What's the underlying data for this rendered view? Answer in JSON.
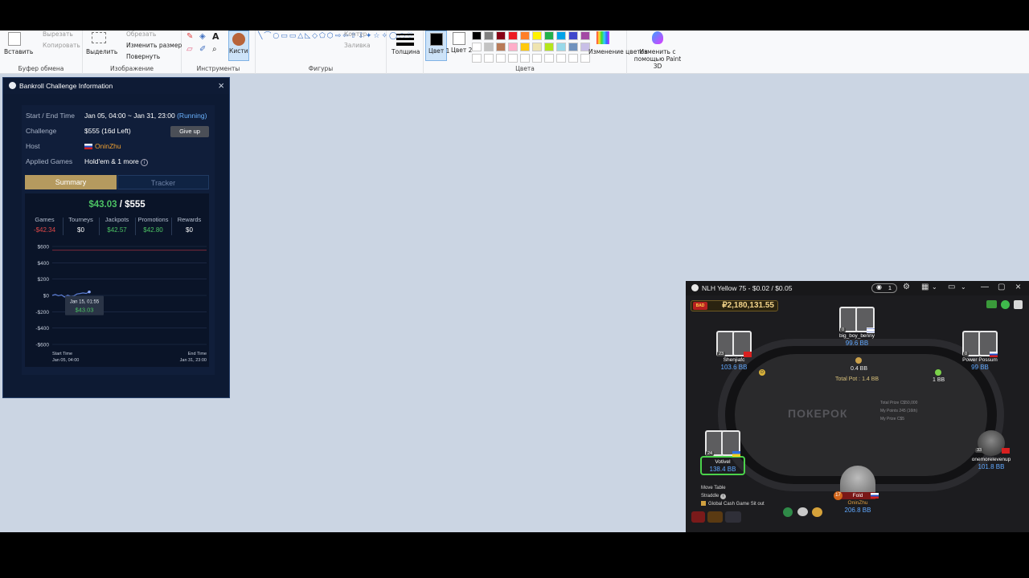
{
  "paint": {
    "groups": [
      {
        "label": "Буфер обмена",
        "items": [
          "Вставить",
          "Вырезать",
          "Копировать"
        ]
      },
      {
        "label": "Изображение",
        "items": [
          "Выделить",
          "Обрезать",
          "Изменить размер",
          "Повернуть"
        ]
      },
      {
        "label": "Инструменты",
        "items": [
          "Кисти"
        ]
      },
      {
        "label": "Фигуры",
        "items": [
          "Контур",
          "Заливка"
        ]
      },
      {
        "label": "",
        "items": [
          "Толщина"
        ]
      },
      {
        "label": "Цвета",
        "items": [
          "Цвет 1",
          "Цвет 2",
          "Изменение цветов",
          "Изменить с помощью Paint 3D"
        ]
      }
    ],
    "colors_row1": [
      "#000000",
      "#7f7f7f",
      "#880015",
      "#ed1c24",
      "#ff7f27",
      "#fff200",
      "#22b14c",
      "#00a2e8",
      "#3f48cc",
      "#a349a4"
    ],
    "colors_row2": [
      "#ffffff",
      "#c3c3c3",
      "#b97a57",
      "#ffaec9",
      "#ffc90e",
      "#efe4b0",
      "#b5e61d",
      "#99d9ea",
      "#7092be",
      "#c8bfe7"
    ]
  },
  "bankroll": {
    "title": "Bankroll Challenge Information",
    "rows": {
      "start_end_label": "Start / End Time",
      "start_end_value": "Jan 05, 04:00 ~ Jan 31, 23:00",
      "status": "(Running)",
      "challenge_label": "Challenge",
      "challenge_value": "$555 (16d Left)",
      "give_up": "Give up",
      "host_label": "Host",
      "host_value": "OninZhu",
      "games_label": "Applied Games",
      "games_value": "Hold'em & 1 more"
    },
    "tabs": [
      "Summary",
      "Tracker"
    ],
    "current": "$43.03",
    "separator": " / ",
    "target": "$555",
    "columns": [
      {
        "label": "Games",
        "value": "-$42.34",
        "tone": "neg"
      },
      {
        "label": "Tourneys",
        "value": "$0",
        "tone": "wht"
      },
      {
        "label": "Jackpots",
        "value": "$42.57",
        "tone": "pos"
      },
      {
        "label": "Promotions",
        "value": "$42.80",
        "tone": "pos"
      },
      {
        "label": "Rewards",
        "value": "$0",
        "tone": "wht"
      }
    ],
    "chart_data": {
      "type": "line",
      "y_ticks": [
        "$600",
        "$400",
        "$200",
        "$0",
        "-$200",
        "-$400",
        "-$600"
      ],
      "ylim": [
        -600,
        600
      ],
      "x_start_label": "Start Time",
      "x_start_value": "Jan 05, 04:00",
      "x_end_label": "End Time",
      "x_end_value": "Jan 31, 23:00",
      "target_line": 555,
      "series": [
        {
          "values": [
            0,
            12,
            -4,
            6,
            -20,
            3,
            -12,
            -6,
            18,
            24,
            30,
            25,
            43.03
          ]
        }
      ],
      "tooltip_date": "Jan 15, 01:55",
      "tooltip_value": "$43.03"
    }
  },
  "poker": {
    "title": "NLH Yellow 75 - $0.02 / $0.05",
    "eye_count": "1",
    "jackpot": "₽2,180,131.55",
    "brand": "ПОКЕРОК",
    "seats": [
      {
        "name": "big_boy_benny",
        "bb": "99.6 BB",
        "lvl": "0",
        "flag": "il"
      },
      {
        "name": "Shenjiafc",
        "bb": "103.6 BB",
        "lvl": "23",
        "flag": "cn"
      },
      {
        "name": "Power Possum",
        "bb": "99 BB",
        "lvl": "0",
        "flag": "ru"
      },
      {
        "name": "Votivel",
        "bb": "138.4 BB",
        "lvl": "24",
        "flag": "ua"
      },
      {
        "name": "onemorelevenup",
        "bb": "101.8 BB",
        "lvl": "33",
        "flag": "cn"
      }
    ],
    "hero": {
      "name": "OninZhu",
      "bb": "206.8 BB",
      "action": "Fold",
      "lvl": "17"
    },
    "bet_center": "0.4 BB",
    "bet_right": "1 BB",
    "total_pot": "Total Pot : 1.4 BB",
    "side_info": [
      "Total Prize  C$50,000",
      "My Points  245 (16th)",
      "My Prize  C$5"
    ],
    "menu": [
      "Move Table",
      "Straddle",
      "Global Cash Game Sit out"
    ]
  }
}
